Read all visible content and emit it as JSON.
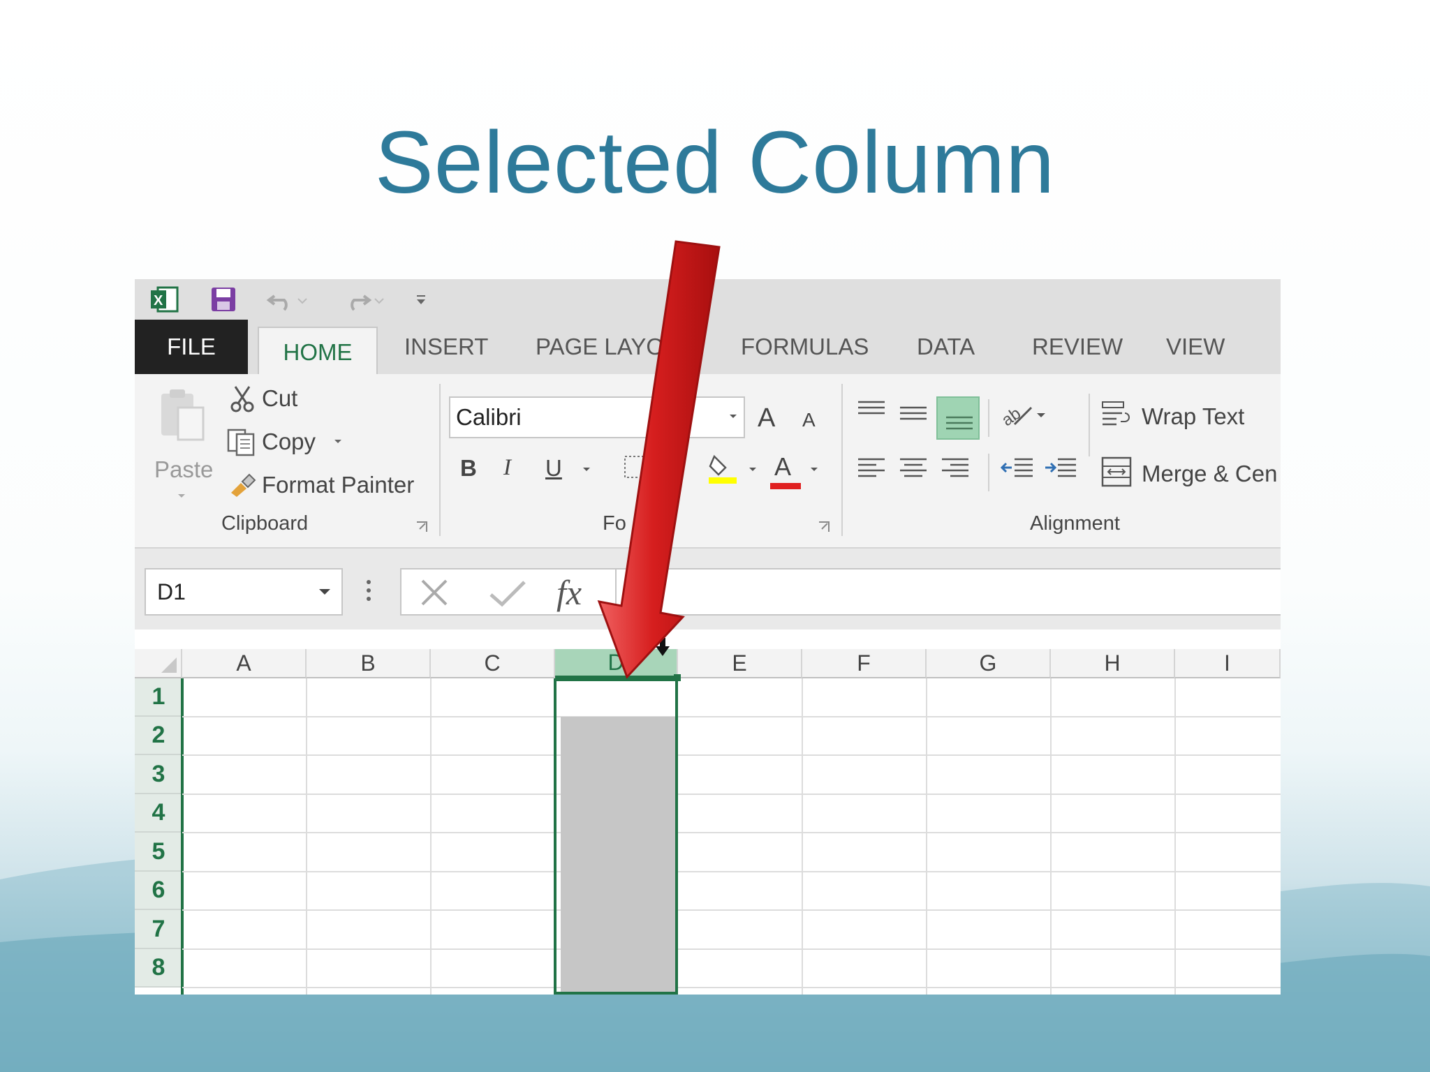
{
  "slide": {
    "title": "Selected Column"
  },
  "app": {
    "qat": {
      "excel_icon": "excel-logo",
      "save_icon": "save-icon",
      "undo_icon": "undo-icon",
      "redo_icon": "redo-icon",
      "customize_icon": "customize-qat-icon"
    },
    "tabs": [
      {
        "label": "FILE"
      },
      {
        "label": "HOME"
      },
      {
        "label": "INSERT"
      },
      {
        "label": "PAGE LAYOU"
      },
      {
        "label": "FORMULAS"
      },
      {
        "label": "DATA"
      },
      {
        "label": "REVIEW"
      },
      {
        "label": "VIEW"
      }
    ],
    "clipboard": {
      "paste": "Paste",
      "cut": "Cut",
      "copy": "Copy",
      "format_painter": "Format Painter",
      "group_label": "Clipboard"
    },
    "font": {
      "font_name": "Calibri",
      "bold": "B",
      "italic": "I",
      "underline": "U",
      "grow": "A",
      "shrink": "A",
      "font_color": "A",
      "group_label": "Fo"
    },
    "alignment": {
      "wrap_text": "Wrap Text",
      "merge_center": "Merge & Cen",
      "group_label": "Alignment"
    },
    "formula_bar": {
      "name_box": "D1",
      "fx": "fx",
      "value": ""
    },
    "columns": [
      "A",
      "B",
      "C",
      "D",
      "E",
      "F",
      "G",
      "H",
      "I"
    ],
    "rows": [
      "1",
      "2",
      "3",
      "4",
      "5",
      "6",
      "7",
      "8"
    ],
    "selected_column": "D",
    "colors": {
      "accent": "#217346",
      "title": "#2e7a9a",
      "arrow": "#d9201f"
    }
  }
}
